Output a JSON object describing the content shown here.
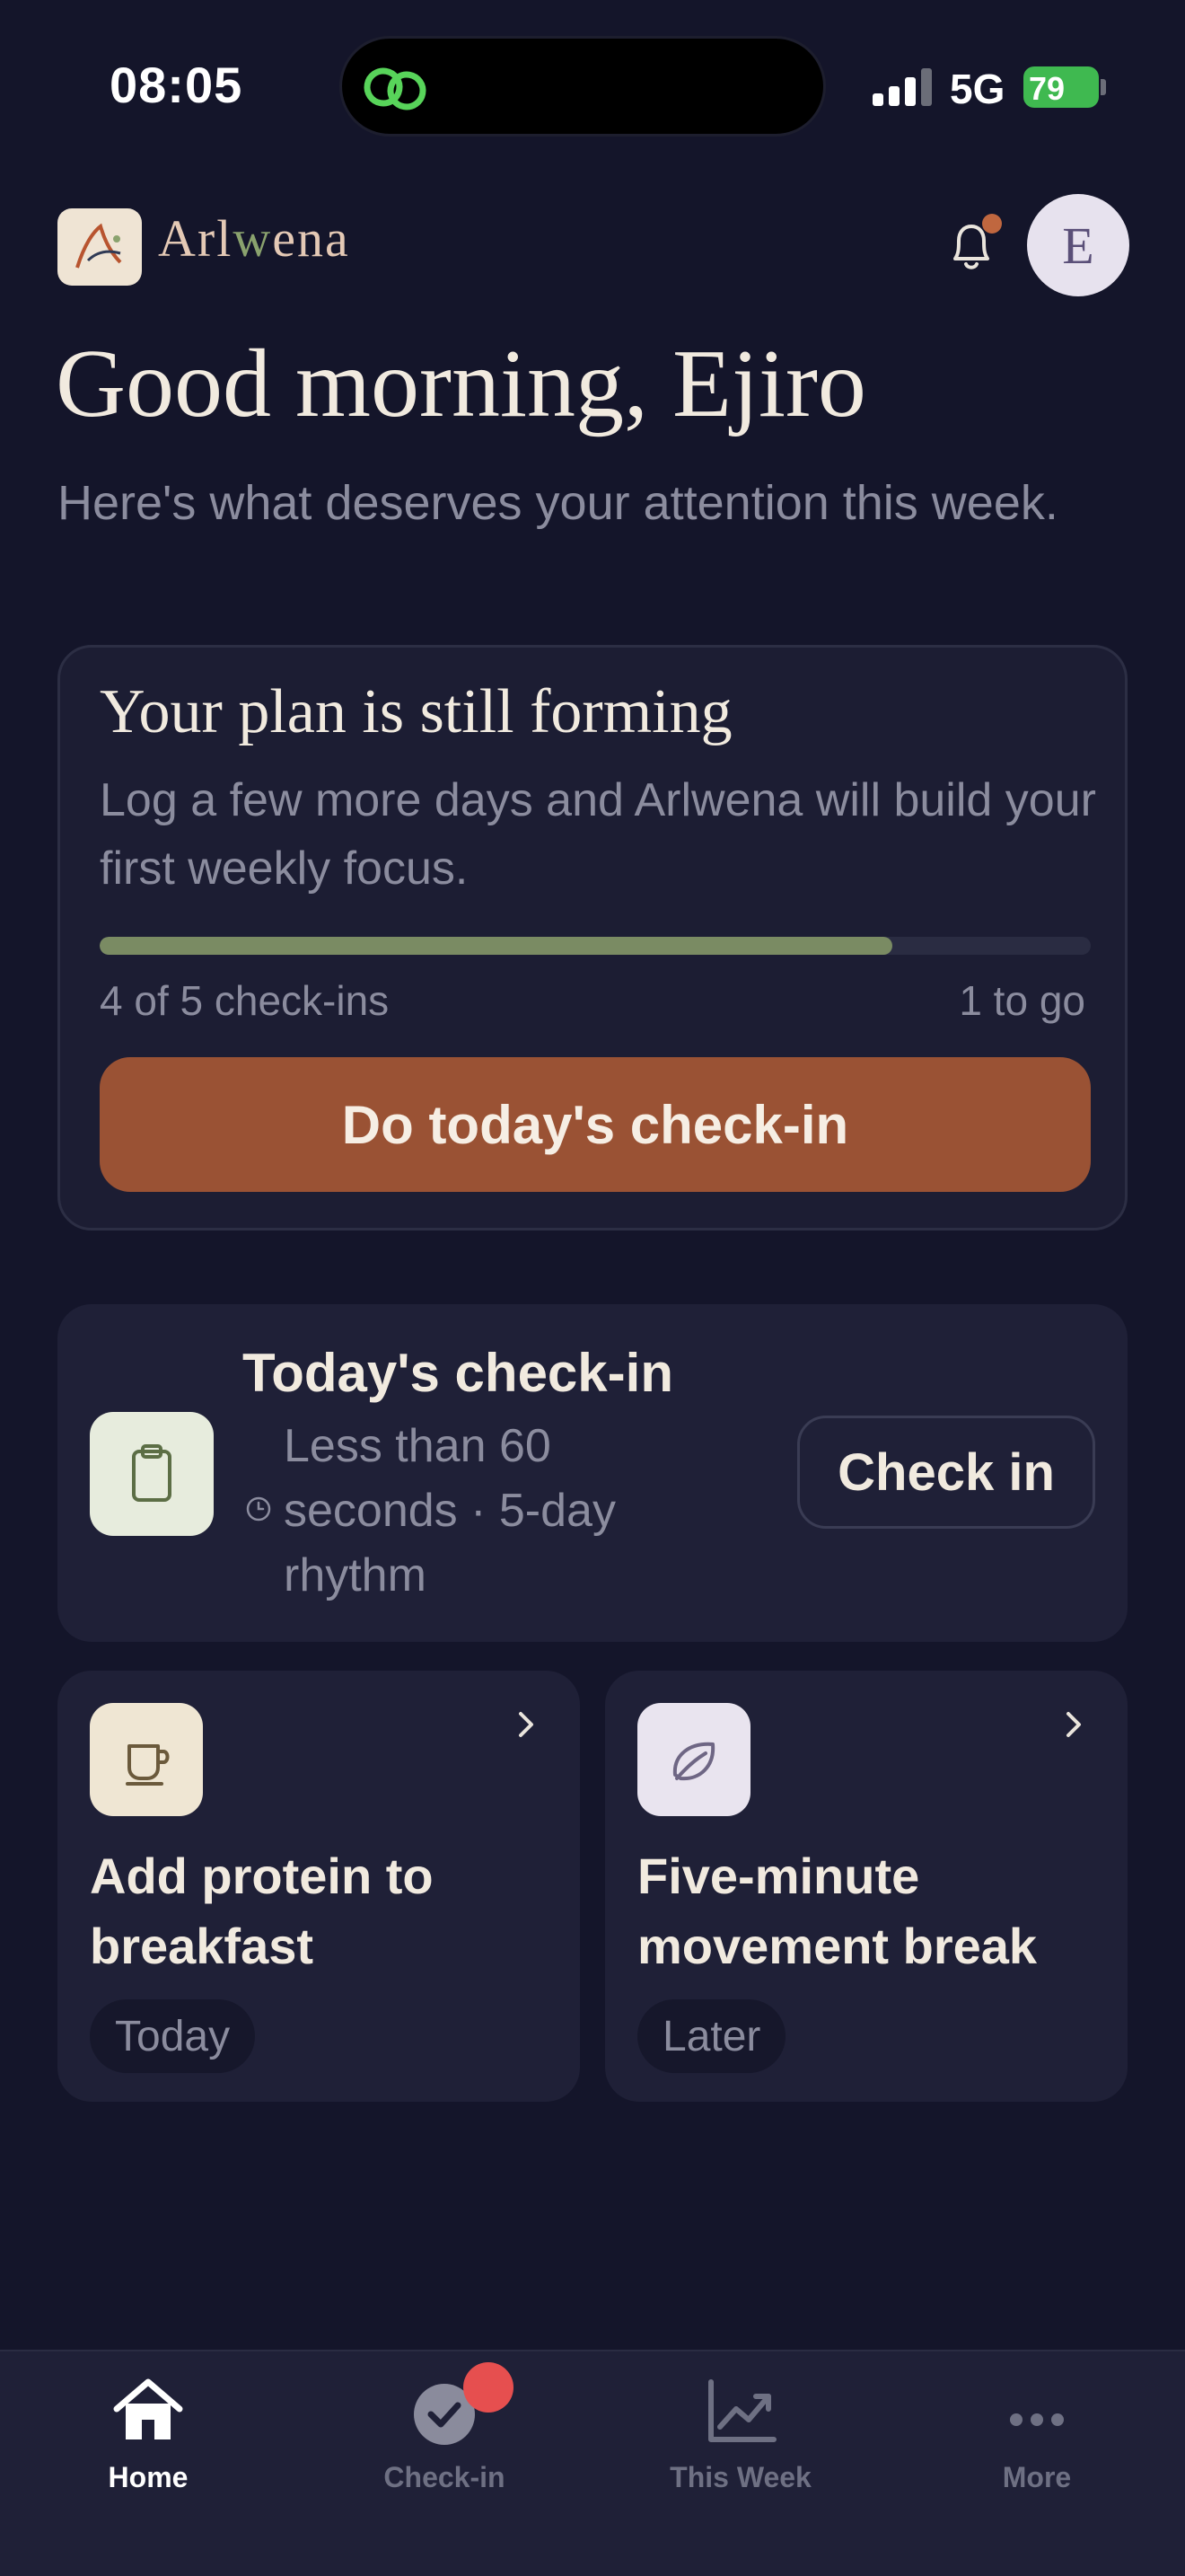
{
  "status_bar": {
    "time": "08:05",
    "network": "5G",
    "battery": "79"
  },
  "header": {
    "brand_prefix": "Arl",
    "brand_accent": "w",
    "brand_suffix": "ena",
    "avatar_initial": "E",
    "has_notification": true
  },
  "greeting": "Good morning, Ejiro",
  "subtitle": "Here's what deserves your attention this week.",
  "plan_card": {
    "title": "Your plan is still forming",
    "description": "Log a few more days and Arlwena will build your first weekly focus.",
    "progress_fraction": 0.8,
    "progress_left": "4 of 5 check-ins",
    "progress_right": "1 to go",
    "button_label": "Do today's check-in"
  },
  "checkin_card": {
    "title": "Today's check-in",
    "meta": "Less than 60 seconds · 5-day rhythm",
    "button_label": "Check in"
  },
  "tasks": [
    {
      "title": "Add protein to breakfast",
      "tag": "Today",
      "icon": "cup-icon",
      "icon_bg": "#efe6d3"
    },
    {
      "title": "Five-minute movement break",
      "tag": "Later",
      "icon": "leaf-icon",
      "icon_bg": "#e9e4ef"
    }
  ],
  "tabbar": {
    "items": [
      {
        "label": "Home",
        "icon": "home-icon",
        "active": true
      },
      {
        "label": "Check-in",
        "icon": "check-circle-icon",
        "active": false,
        "badge": true
      },
      {
        "label": "This Week",
        "icon": "chart-icon",
        "active": false
      },
      {
        "label": "More",
        "icon": "more-icon",
        "active": false
      }
    ]
  },
  "colors": {
    "background": "#14152a",
    "card": "#1f2037",
    "accent_button": "#9a5234",
    "progress": "#7a8b63",
    "muted_text": "#8b8c9e",
    "badge": "#e64f4f"
  }
}
